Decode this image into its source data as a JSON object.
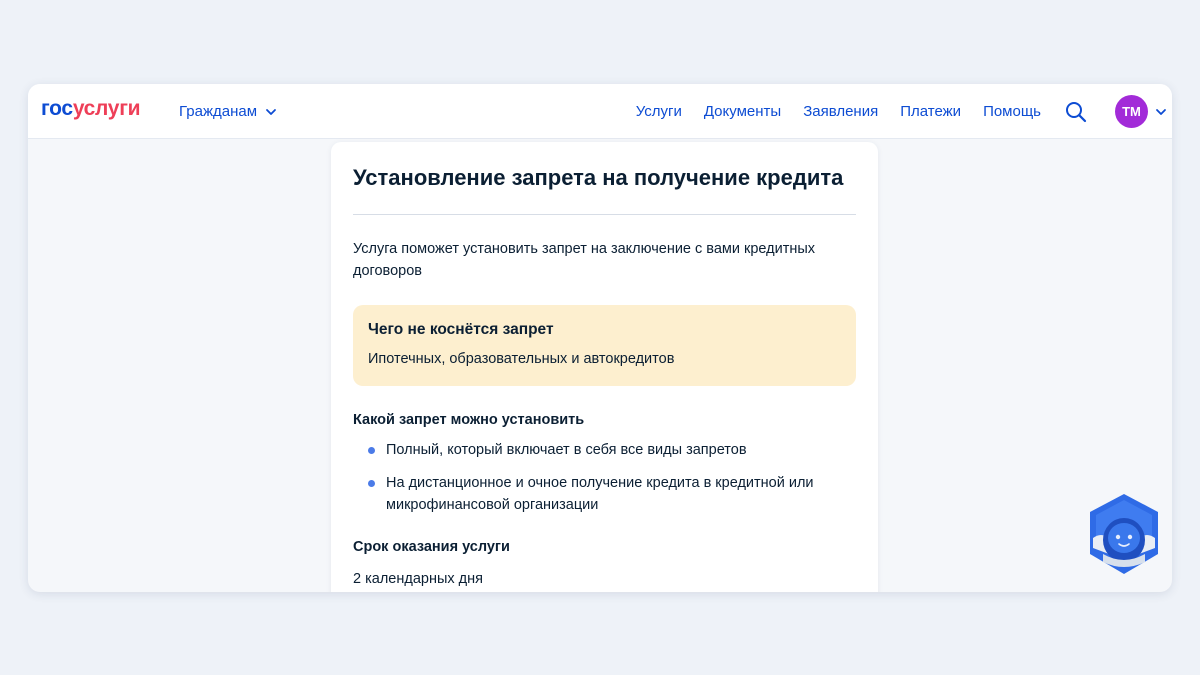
{
  "header": {
    "logo_part1": "гос",
    "logo_part2": "услуги",
    "audience_menu": "Гражданам",
    "nav": [
      "Услуги",
      "Документы",
      "Заявления",
      "Платежи",
      "Помощь"
    ],
    "avatar_initials": "ТМ",
    "icons": {
      "search": "search-icon",
      "chevron": "chevron-down-icon"
    },
    "colors": {
      "brand_blue": "#0d4cd3",
      "brand_red": "#ee3f58",
      "avatar": "#a22bd8"
    }
  },
  "card": {
    "title": "Установление запрета на получение кредита",
    "lead": "Услуга поможет установить запрет на заключение с вами кредитных договоров",
    "notice": {
      "title": "Чего не коснётся запрет",
      "text": "Ипотечных, образовательных и автокредитов",
      "bg_color": "#fdefcf"
    },
    "ban_types": {
      "title": "Какой запрет можно установить",
      "items": [
        "Полный, который включает в себя все виды запретов",
        "На дистанционное и очное получение кредита в кредитной или микрофинансовой организации"
      ]
    },
    "duration": {
      "title": "Срок оказания услуги",
      "value": "2 календарных дня"
    }
  },
  "assistant": {
    "icon": "robot-assistant-icon"
  }
}
